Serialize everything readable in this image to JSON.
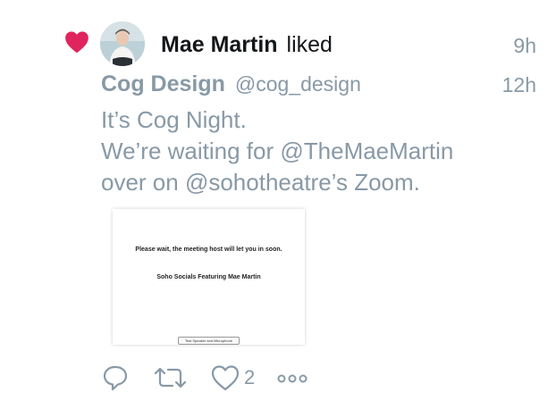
{
  "activity": {
    "actor_name": "Mae Martin",
    "verb": "liked",
    "time": "9h",
    "heart_color": "#e0245e"
  },
  "tweet": {
    "author": "Cog Design",
    "handle": "@cog_design",
    "time": "12h",
    "lines": [
      "It’s Cog Night.",
      "We’re waiting for @TheMaeMartin",
      "over on @sohotheatre’s Zoom."
    ],
    "media": {
      "wait_text": "Please wait, the meeting host will let you in soon.",
      "meeting_title": "Soho Socials Featuring Mae Martin",
      "button_label": "Test Speaker and Microphone"
    },
    "actions": {
      "reply_icon": "reply-icon",
      "retweet_icon": "retweet-icon",
      "like_icon": "like-icon",
      "like_count": "2",
      "more_icon": "more-icon"
    }
  },
  "colors": {
    "muted_text": "#8899a6",
    "primary_text": "#14171a"
  }
}
